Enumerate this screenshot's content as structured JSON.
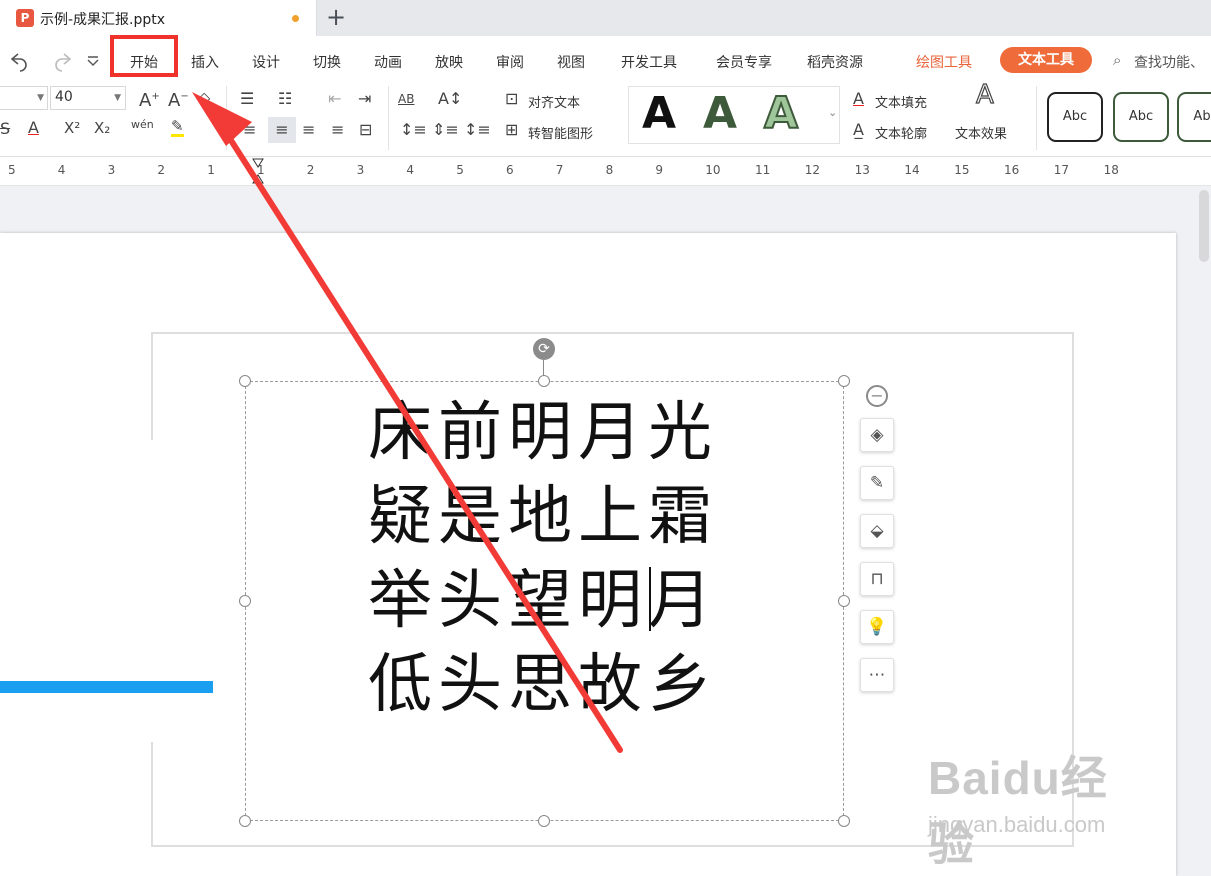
{
  "tab": {
    "title": "示例-成果汇报.pptx",
    "app_letter": "P",
    "new_tab": "+"
  },
  "menu": {
    "items": [
      "开始",
      "插入",
      "设计",
      "切换",
      "动画",
      "放映",
      "审阅",
      "视图",
      "开发工具",
      "会员专享",
      "稻壳资源"
    ],
    "drawing_tool": "绘图工具",
    "text_tool": "文本工具",
    "search": "查找功能、"
  },
  "ribbon": {
    "font_size": "40",
    "phonetic": "wén",
    "align_text": "对齐文本",
    "smart_shape": "转智能图形",
    "style_letter": "A",
    "text_fill": "文本填充",
    "text_outline": "文本轮廓",
    "text_effect": "文本效果",
    "shape_styles": [
      "Abc",
      "Abc",
      "Ab"
    ]
  },
  "ruler": {
    "ticks": [
      "5",
      "4",
      "3",
      "2",
      "1",
      "1",
      "2",
      "3",
      "4",
      "5",
      "6",
      "7",
      "8",
      "9",
      "10",
      "11",
      "12",
      "13",
      "14",
      "15",
      "16",
      "17",
      "18"
    ]
  },
  "slide": {
    "poem_lines": [
      "床前明月光",
      "疑是地上霜",
      "举头望明月",
      "低头思故乡"
    ]
  },
  "watermark": {
    "logo": "Baidu经验",
    "url": "jingyan.baidu.com"
  },
  "colors": {
    "accent_orange": "#ef6b3a",
    "highlight_red": "#f0312c",
    "blue_bar": "#1a9ef0"
  }
}
